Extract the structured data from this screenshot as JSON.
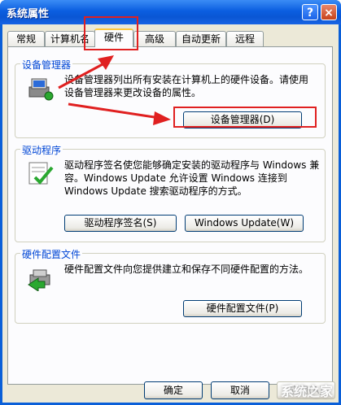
{
  "window": {
    "title": "系统属性"
  },
  "titlebar": {
    "help_label": "?",
    "close_label": "×"
  },
  "tabs": [
    {
      "label": "常规"
    },
    {
      "label": "计算机名"
    },
    {
      "label": "硬件"
    },
    {
      "label": "高级"
    },
    {
      "label": "自动更新"
    },
    {
      "label": "远程"
    }
  ],
  "device_manager": {
    "title": "设备管理器",
    "description": "设备管理器列出所有安装在计算机上的硬件设备。请使用设备管理器来更改设备的属性。",
    "button": "设备管理器(D)"
  },
  "drivers": {
    "title": "驱动程序",
    "description": "驱动程序签名使您能够确定安装的驱动程序与 Windows 兼容。Windows Update 允许设置 Windows 连接到 Windows Update 搜索驱动程序的方式。",
    "signing_button": "驱动程序签名(S)",
    "update_button": "Windows Update(W)"
  },
  "hardware_profiles": {
    "title": "硬件配置文件",
    "description": "硬件配置文件向您提供建立和保存不同硬件配置的方法。",
    "button": "硬件配置文件(P)"
  },
  "footer": {
    "ok": "确定",
    "cancel": "取消",
    "apply": "应用(A)"
  },
  "watermark": "系统之家",
  "colors": {
    "highlight": "#e02020",
    "group_title": "#0046d5",
    "titlebar": "#0a5fd8"
  }
}
